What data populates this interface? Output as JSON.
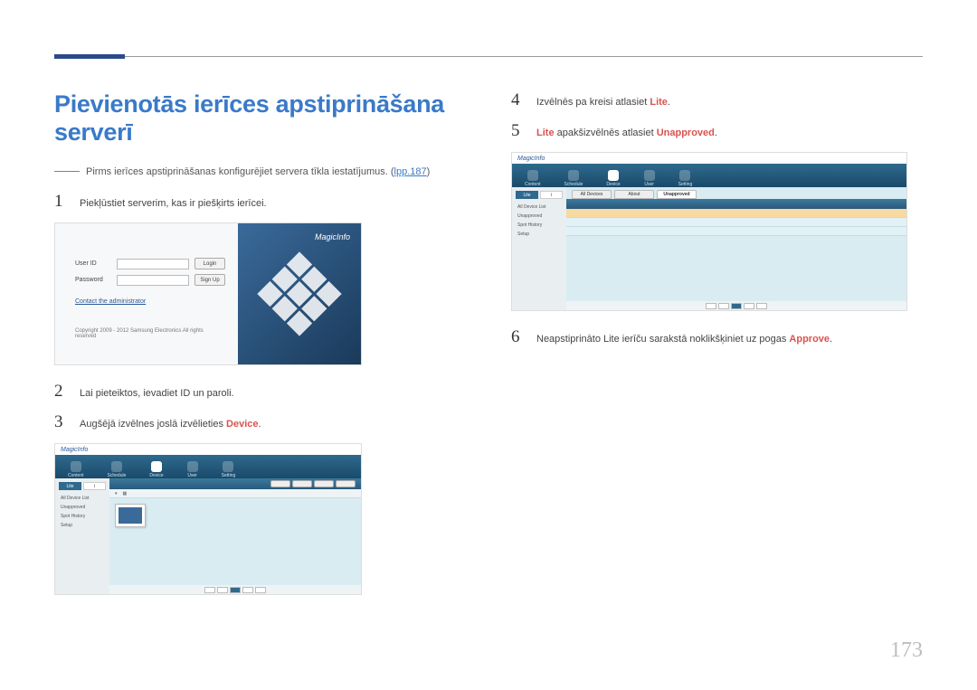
{
  "page_number": "173",
  "title": "Pievienotās ierīces apstiprināšana serverī",
  "precursor": {
    "dash": "――",
    "text": "Pirms ierīces apstiprināšanas konfigurējiet servera tīkla iestatījumus. (",
    "link": "lpp.187",
    "close": ")"
  },
  "steps": {
    "s1": {
      "num": "1",
      "text": "Piekļūstiet serverim, kas ir piešķirts ierīcei."
    },
    "s2": {
      "num": "2",
      "text": "Lai pieteiktos, ievadiet ID un paroli."
    },
    "s3": {
      "num": "3",
      "pre": "Augšējā izvēlnes joslā izvēlieties ",
      "hl": "Device",
      "post": "."
    },
    "s4": {
      "num": "4",
      "pre": "Izvēlnēs pa kreisi atlasiet ",
      "hl": "Lite",
      "post": "."
    },
    "s5": {
      "num": "5",
      "hl1": "Lite",
      "mid": " apakšizvēlnēs atlasiet ",
      "hl2": "Unapproved",
      "post": "."
    },
    "s6": {
      "num": "6",
      "pre": "Neapstiprināto Lite ierīču sarakstā noklikšķiniet uz pogas ",
      "hl": "Approve",
      "post": "."
    }
  },
  "login_panel": {
    "brand": "MagicInfo",
    "user_label": "User ID",
    "pass_label": "Password",
    "login_btn": "Login",
    "signup_btn": "Sign Up",
    "admin_link": "Contact the administrator",
    "copyright": "Copyright 2009 - 2012 Samsung Electronics All rights reserved"
  },
  "app": {
    "brand": "MagicInfo",
    "nav": [
      "Content",
      "Schedule",
      "Device",
      "User",
      "Setting"
    ],
    "side_tabs": [
      "Lite",
      "i"
    ],
    "side_items": [
      "All Device List",
      "Unapproved",
      "Spot History",
      "Setup"
    ],
    "table_tabs": [
      "All Devices",
      "About",
      "Unapproved"
    ]
  }
}
